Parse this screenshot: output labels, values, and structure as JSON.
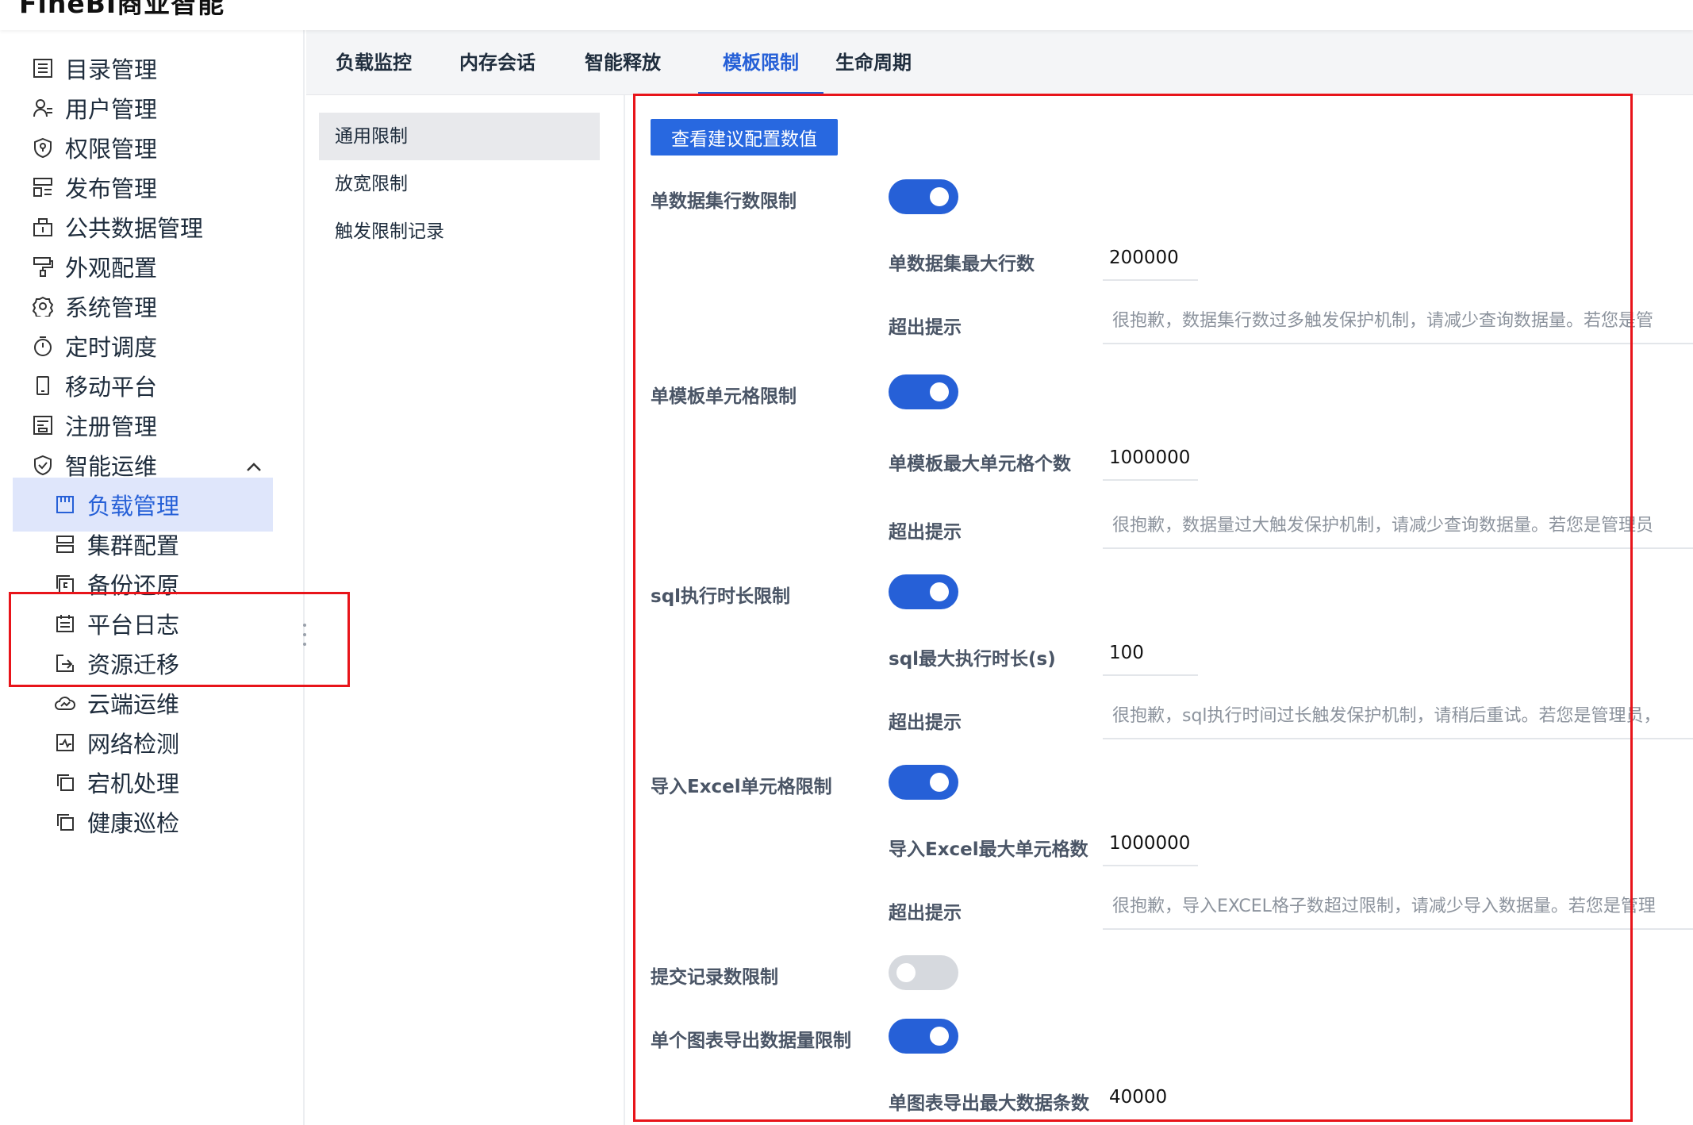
{
  "app": {
    "brand": "FineBI商业智能"
  },
  "sidebar": {
    "items": [
      {
        "label": "目录管理",
        "icon": "list-icon"
      },
      {
        "label": "用户管理",
        "icon": "user-icon"
      },
      {
        "label": "权限管理",
        "icon": "shield-icon"
      },
      {
        "label": "发布管理",
        "icon": "publish-icon"
      },
      {
        "label": "公共数据管理",
        "icon": "data-icon"
      },
      {
        "label": "外观配置",
        "icon": "paint-roller-icon"
      },
      {
        "label": "系统管理",
        "icon": "gear-icon"
      },
      {
        "label": "定时调度",
        "icon": "timer-icon"
      },
      {
        "label": "移动平台",
        "icon": "mobile-icon"
      },
      {
        "label": "注册管理",
        "icon": "register-icon"
      },
      {
        "label": "智能运维",
        "icon": "ops-icon"
      }
    ],
    "sub_items": [
      {
        "label": "负载管理",
        "icon": "load-icon"
      },
      {
        "label": "集群配置",
        "icon": "cluster-icon"
      },
      {
        "label": "备份还原",
        "icon": "backup-icon"
      },
      {
        "label": "平台日志",
        "icon": "calendar-log-icon"
      },
      {
        "label": "资源迁移",
        "icon": "migrate-icon"
      },
      {
        "label": "云端运维",
        "icon": "cloud-icon"
      },
      {
        "label": "网络检测",
        "icon": "network-icon"
      },
      {
        "label": "宕机处理",
        "icon": "copy-icon"
      },
      {
        "label": "健康巡检",
        "icon": "copy-icon"
      }
    ]
  },
  "tabs": [
    "负载监控",
    "内存会话",
    "智能释放",
    "模板限制",
    "生命周期"
  ],
  "active_tab": "模板限制",
  "submenu": [
    "通用限制",
    "放宽限制",
    "触发限制记录"
  ],
  "content": {
    "suggest_button": "查看建议配置数值",
    "rows": [
      {
        "label": "单数据集行数限制",
        "enabled": true,
        "max_label": "单数据集最大行数",
        "max_value": "200000",
        "hint_label": "超出提示",
        "hint_placeholder": "很抱歉，数据集行数过多触发保护机制，请减少查询数据量。若您是管"
      },
      {
        "label": "单模板单元格限制",
        "enabled": true,
        "max_label": "单模板最大单元格个数",
        "max_value": "1000000",
        "hint_label": "超出提示",
        "hint_placeholder": "很抱歉，数据量过大触发保护机制，请减少查询数据量。若您是管理员"
      },
      {
        "label": "sql执行时长限制",
        "enabled": true,
        "max_label": "sql最大执行时长(s)",
        "max_value": "100",
        "hint_label": "超出提示",
        "hint_placeholder": "很抱歉，sql执行时间过长触发保护机制，请稍后重试。若您是管理员，"
      },
      {
        "label": "导入Excel单元格限制",
        "enabled": true,
        "max_label": "导入Excel最大单元格数",
        "max_value": "1000000",
        "hint_label": "超出提示",
        "hint_placeholder": "很抱歉，导入EXCEL格子数超过限制，请减少导入数据量。若您是管理"
      },
      {
        "label": "提交记录数限制",
        "enabled": false
      },
      {
        "label": "单个图表导出数据量限制",
        "enabled": true,
        "max_label": "单图表导出最大数据条数",
        "max_value": "40000"
      }
    ]
  },
  "colors": {
    "accent": "#2660d7",
    "annotation": "#e8141a"
  }
}
